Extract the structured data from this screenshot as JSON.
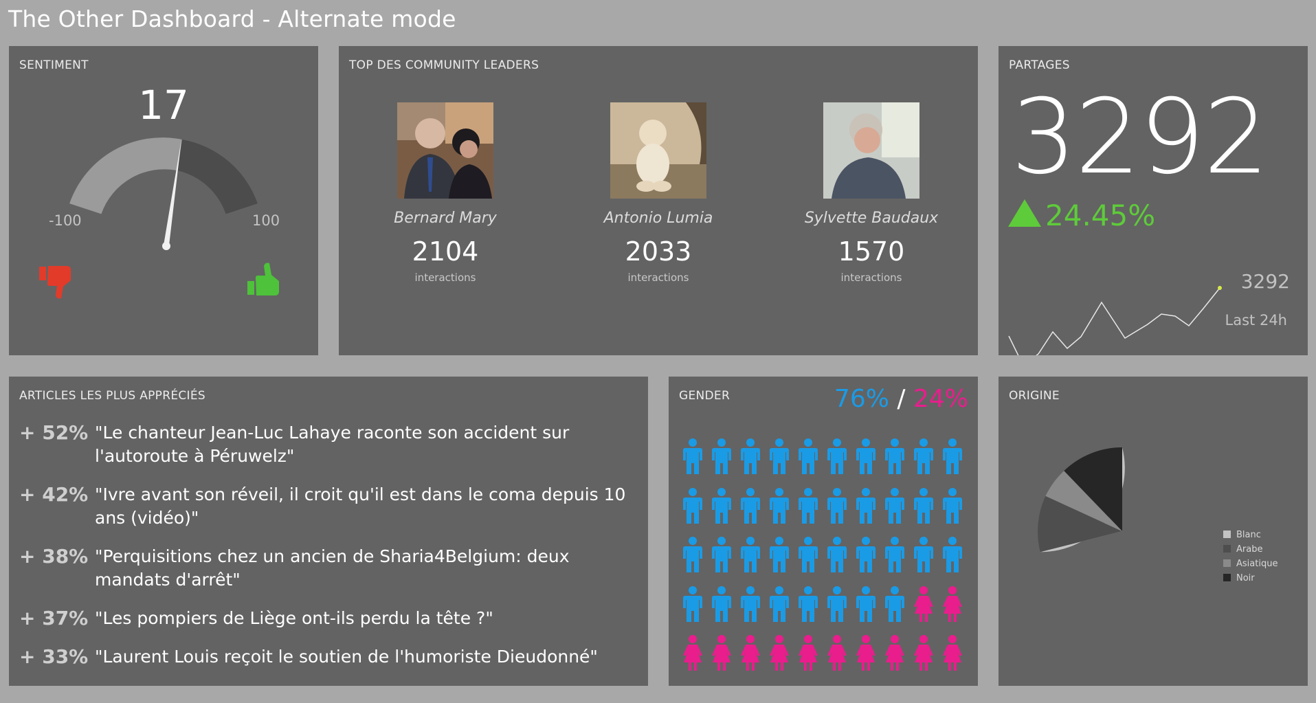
{
  "page": {
    "title": "The Other Dashboard - Alternate mode"
  },
  "sentiment": {
    "title": "SENTIMENT",
    "value": "17",
    "value_num": 17,
    "min_label": "-100",
    "max_label": "100",
    "min": -100,
    "max": 100
  },
  "leaders": {
    "title": "TOP DES COMMUNITY LEADERS",
    "items": [
      {
        "name": "Bernard Mary",
        "count": "2104",
        "unit": "interactions"
      },
      {
        "name": "Antonio Lumia",
        "count": "2033",
        "unit": "interactions"
      },
      {
        "name": "Sylvette Baudaux",
        "count": "1570",
        "unit": "interactions"
      }
    ]
  },
  "partages": {
    "title": "PARTAGES",
    "value": "3292",
    "change": "24.45%",
    "sparkline_value": "3292",
    "sparkline_label": "Last 24h",
    "up_color": "#5ecb3a"
  },
  "articles": {
    "title": "ARTICLES LES PLUS APPRÉCIÉS",
    "items": [
      {
        "pct": "+ 52%",
        "text": "\"Le chanteur Jean-Luc Lahaye raconte son accident sur l'autoroute à Péruwelz\""
      },
      {
        "pct": "+ 42%",
        "text": "\"Ivre avant son réveil, il croit qu'il est dans le coma depuis 10 ans (vidéo)\""
      },
      {
        "pct": "+ 38%",
        "text": "\"Perquisitions chez un ancien de Sharia4Belgium: deux mandats d'arrêt\""
      },
      {
        "pct": "+ 37%",
        "text": "\"Les pompiers de Liège ont-ils perdu la tête ?\""
      },
      {
        "pct": "+ 33%",
        "text": "\"Laurent Louis reçoit le soutien de l'humoriste Dieudonné\""
      }
    ]
  },
  "gender": {
    "title": "GENDER",
    "male_pct": "76%",
    "separator": "/",
    "female_pct": "24%",
    "male_count": 38,
    "female_count": 12,
    "male_color": "#1a9be6",
    "female_color": "#ea1d8d"
  },
  "origine": {
    "title": "ORIGINE",
    "legend": [
      {
        "label": "Blanc",
        "color": "#c3c3c3"
      },
      {
        "label": "Arabe",
        "color": "#4e4e4e"
      },
      {
        "label": "Asiatique",
        "color": "#8a8a8a"
      },
      {
        "label": "Noir",
        "color": "#262626"
      }
    ]
  }
}
